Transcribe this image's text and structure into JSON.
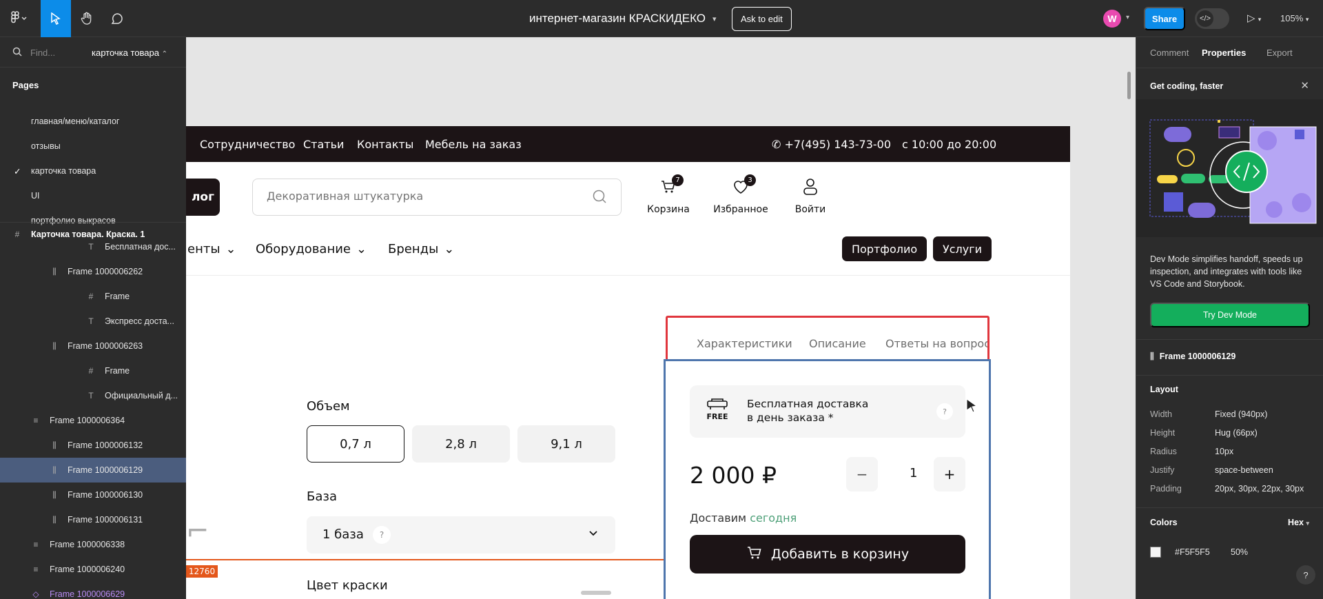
{
  "toolbar": {
    "file_title": "интернет-магазин КРАСКИДЕКО",
    "ask_to_edit": "Ask to edit",
    "avatar_initial": "W",
    "share": "Share",
    "zoom": "105%"
  },
  "left_panel": {
    "search_placeholder": "Find...",
    "current_page": "карточка товара",
    "pages_heading": "Pages",
    "pages": [
      {
        "label": "главная/меню/каталог",
        "checked": false
      },
      {
        "label": "отзывы",
        "checked": false
      },
      {
        "label": "карточка товара",
        "checked": true
      },
      {
        "label": "UI",
        "checked": false
      },
      {
        "label": "портфолио выкрасов",
        "checked": false
      }
    ],
    "root_frame": "Карточка товара. Краска. 1",
    "layers": [
      {
        "label": "Бесплатная дос...",
        "icon": "text-icon",
        "indent": 3
      },
      {
        "label": "Frame 1000006262",
        "icon": "auto-layout-icon",
        "indent": 2
      },
      {
        "label": "Frame",
        "icon": "frame-icon",
        "indent": 3
      },
      {
        "label": "Экспресс доста...",
        "icon": "text-icon",
        "indent": 3
      },
      {
        "label": "Frame 1000006263",
        "icon": "auto-layout-icon",
        "indent": 2
      },
      {
        "label": "Frame",
        "icon": "frame-icon",
        "indent": 3
      },
      {
        "label": "Официальный д...",
        "icon": "text-icon",
        "indent": 3
      },
      {
        "label": "Frame 1000006364",
        "icon": "stack-icon",
        "indent": 1
      },
      {
        "label": "Frame 1000006132",
        "icon": "auto-layout-icon",
        "indent": 2
      },
      {
        "label": "Frame 1000006129",
        "icon": "auto-layout-icon",
        "indent": 2,
        "selected": true
      },
      {
        "label": "Frame 1000006130",
        "icon": "auto-layout-icon",
        "indent": 2
      },
      {
        "label": "Frame 1000006131",
        "icon": "auto-layout-icon",
        "indent": 2
      },
      {
        "label": "Frame 1000006338",
        "icon": "stack-icon",
        "indent": 1
      },
      {
        "label": "Frame 1000006240",
        "icon": "stack-icon",
        "indent": 1
      },
      {
        "label": "Frame 1000006629",
        "icon": "component-icon",
        "indent": 1,
        "component": true
      }
    ]
  },
  "site": {
    "nav": [
      "Сотрудничество",
      "Статьи",
      "Контакты",
      "Мебель на заказ"
    ],
    "phone": "+7(495) 143-73-00",
    "hours": "с 10:00 до 20:00",
    "catalog_partial": "лог",
    "search_placeholder": "Декоративная штукатурка",
    "header_icons": [
      {
        "label": "Корзина",
        "badge": "7"
      },
      {
        "label": "Избранное",
        "badge": "3"
      },
      {
        "label": "Войти",
        "badge": ""
      }
    ],
    "menu": [
      "енты",
      "Оборудование",
      "Бренды"
    ],
    "pills": [
      "Портфолио",
      "Услуги"
    ],
    "tabs": [
      "Характеристики",
      "Описание",
      "Ответы на вопросы"
    ],
    "volume_title": "Объем",
    "volumes": [
      {
        "label": "0,7 л",
        "active": true
      },
      {
        "label": "2,8 л",
        "active": false
      },
      {
        "label": "9,1 л",
        "active": false
      }
    ],
    "base_title": "База",
    "base_value": "1 база",
    "help_mark": "?",
    "tag": "12760",
    "color_title": "Цвет краски",
    "card": {
      "free_label": "FREE",
      "delivery_line1": "Бесплатная доставка",
      "delivery_line2": "в день заказа *",
      "price": "2 000 ₽",
      "qty": "1",
      "minus": "−",
      "plus": "+",
      "deliver_prefix": "Доставим",
      "deliver_today": "сегодня",
      "add_to_cart": "Добавить в корзину"
    }
  },
  "right_panel": {
    "tabs": [
      "Comment",
      "Properties",
      "Export"
    ],
    "active_tab": "Properties",
    "promo_title": "Get coding, faster",
    "promo_text": "Dev Mode simplifies handoff, speeds up inspection, and integrates with tools like VS Code and Storybook.",
    "promo_button": "Try Dev Mode",
    "frame_name": "Frame 1000006129",
    "layout_heading": "Layout",
    "layout": [
      {
        "key": "Width",
        "value": "Fixed (940px)"
      },
      {
        "key": "Height",
        "value": "Hug (66px)"
      },
      {
        "key": "Radius",
        "value": "10px"
      },
      {
        "key": "Justify",
        "value": "space-between"
      },
      {
        "key": "Padding",
        "value": "20px, 30px, 22px, 30px"
      }
    ],
    "colors_heading": "Colors",
    "color_format": "Hex",
    "color_value": "#F5F5F5",
    "color_opacity": "50%",
    "help": "?"
  }
}
